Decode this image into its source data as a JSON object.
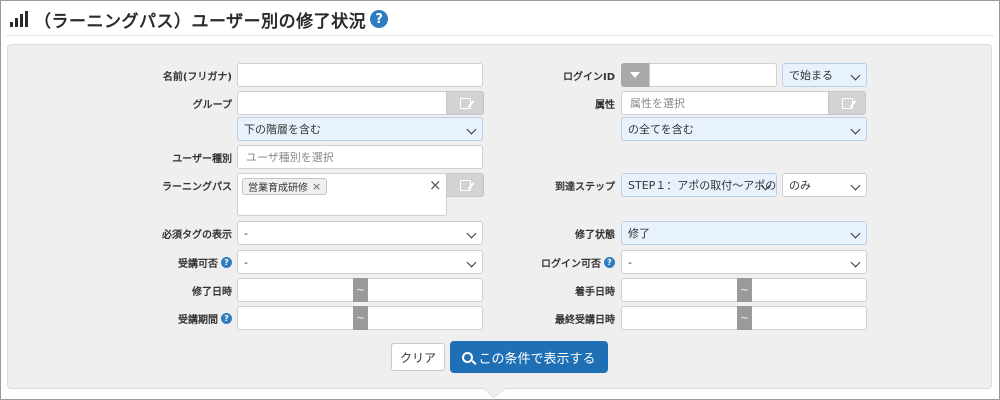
{
  "header": {
    "title": "（ラーニングパス）ユーザー別の修了状況",
    "help_glyph": "?"
  },
  "fields": {
    "name": {
      "label": "名前(フリガナ)",
      "value": ""
    },
    "login_id": {
      "label": "ログインID",
      "value": "",
      "match_mode": "で始まる"
    },
    "group": {
      "label": "グループ",
      "value": "",
      "scope": "下の階層を含む"
    },
    "attribute": {
      "label": "属性",
      "placeholder": "属性を選択",
      "scope": "の全てを含む"
    },
    "user_type": {
      "label": "ユーザー種別",
      "placeholder": "ユーザ種別を選択"
    },
    "learning_path": {
      "label": "ラーニングパス",
      "tag": "営業育成研修",
      "tag_remove": "×",
      "clear": "×"
    },
    "step": {
      "label": "到達ステップ",
      "value": "STEP１：アポの取付～アポの",
      "mode": "のみ"
    },
    "required_tag": {
      "label": "必須タグの表示",
      "value": "-"
    },
    "completion_status": {
      "label": "修了状態",
      "value": "修了"
    },
    "enrollable": {
      "label": "受講可否",
      "value": "-"
    },
    "login_allowed": {
      "label": "ログイン可否",
      "value": "-"
    },
    "completed_at": {
      "label": "修了日時",
      "sep": "~"
    },
    "started_at": {
      "label": "着手日時",
      "sep": "~"
    },
    "period": {
      "label": "受講期間",
      "sep": "~"
    },
    "last_access": {
      "label": "最終受講日時",
      "sep": "~"
    }
  },
  "buttons": {
    "clear": "クリア",
    "show": "この条件で表示する"
  },
  "colors": {
    "primary": "#1f6fb5",
    "help": "#2f7bc0",
    "panel": "#efefef",
    "selected_bg": "#e8f2fc"
  }
}
